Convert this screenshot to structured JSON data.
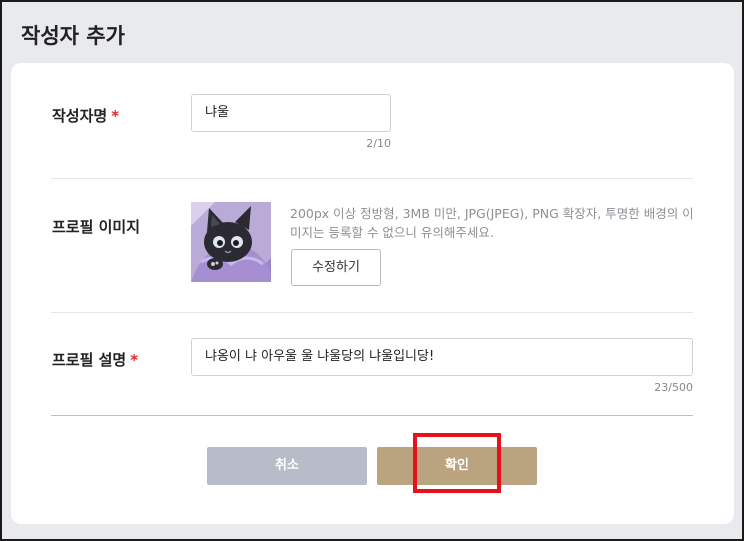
{
  "dialog": {
    "title": "작성자 추가"
  },
  "author_name": {
    "label": "작성자명",
    "required_mark": "*",
    "value": "냐울",
    "counter": "2/10"
  },
  "profile_image": {
    "label": "프로필 이미지",
    "help_text": "200px 이상 정방형, 3MB 미만, JPG(JPEG), PNG 확장자, 투명한 배경의 이미지는 등록할 수 없으니 유의해주세요.",
    "edit_label": "수정하기"
  },
  "profile_desc": {
    "label": "프로필 설명",
    "required_mark": "*",
    "value": "냐옹이 냐 아우울 울 냐울당의 냐울입니당!",
    "counter": "23/500"
  },
  "actions": {
    "cancel_label": "취소",
    "confirm_label": "확인"
  },
  "colors": {
    "background": "#e9eaee",
    "required": "#e0262e",
    "cancel": "#b7bcc8",
    "confirm": "#b9a47f",
    "highlight": "#e8101a"
  }
}
